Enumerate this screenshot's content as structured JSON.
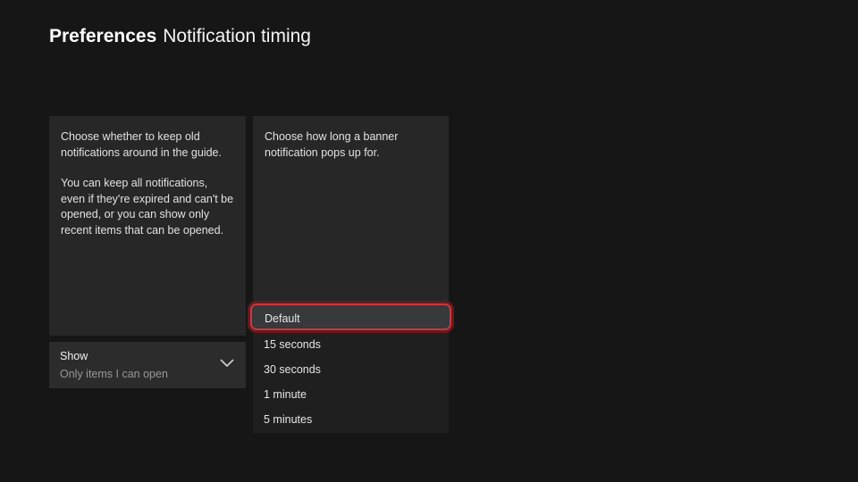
{
  "header": {
    "section_title": "Preferences",
    "page_title": "Notification timing"
  },
  "keep_notifications": {
    "description_paragraph_1": "Choose whether to keep old notifications around in the guide.",
    "description_paragraph_2": "You can keep all notifications, even if they're expired and can't be opened, or you can show only recent items that can be opened.",
    "dropdown": {
      "label": "Show",
      "value": "Only items I can open",
      "icon": "chevron-down"
    }
  },
  "banner_timing": {
    "description": "Choose how long a banner notification pops up for.",
    "dropdown": {
      "selected_option": "Default",
      "options": [
        {
          "label": "Default",
          "selected": true
        },
        {
          "label": "15 seconds",
          "selected": false
        },
        {
          "label": "30 seconds",
          "selected": false
        },
        {
          "label": "1 minute",
          "selected": false
        },
        {
          "label": "5 minutes",
          "selected": false
        }
      ]
    }
  },
  "colors": {
    "focus_ring": "#c8383f",
    "focus_ring_outer": "#69191e",
    "panel_background": "#272727",
    "page_background": "#161616"
  }
}
